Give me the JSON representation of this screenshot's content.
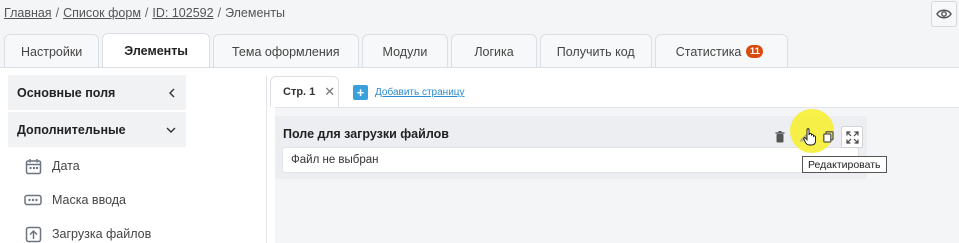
{
  "breadcrumb": {
    "items": [
      "Главная",
      "Список форм",
      "ID: 102592"
    ],
    "current": "Элементы",
    "separator": "/"
  },
  "header": {
    "eye_icon": "eye-icon"
  },
  "tabs": [
    {
      "label": "Настройки"
    },
    {
      "label": "Элементы",
      "active": true
    },
    {
      "label": "Тема оформления"
    },
    {
      "label": "Модули"
    },
    {
      "label": "Логика"
    },
    {
      "label": "Получить код"
    },
    {
      "label": "Статистика",
      "badge": "11"
    }
  ],
  "sidebar": {
    "sections": [
      {
        "label": "Основные поля",
        "chevron": "chevron-left-icon"
      },
      {
        "label": "Дополнительные",
        "chevron": "chevron-down-icon"
      }
    ],
    "items": [
      {
        "label": "Дата",
        "icon": "calendar-icon"
      },
      {
        "label": "Маска ввода",
        "icon": "input-mask-icon"
      },
      {
        "label": "Загрузка файлов",
        "icon": "upload-icon"
      }
    ]
  },
  "canvas": {
    "page_tab": "Стр. 1",
    "add_page": "Добавить страницу",
    "field": {
      "label": "Поле для загрузки файлов",
      "file_status": "Файл не выбран"
    },
    "tooltip": "Редактировать",
    "tools": [
      "trash-icon",
      "edit-icon",
      "copy-icon",
      "expand-icon"
    ]
  },
  "colors": {
    "badge": "#d94a0c",
    "accent": "#3aa0dc",
    "highlight": "#f5ef3a"
  }
}
